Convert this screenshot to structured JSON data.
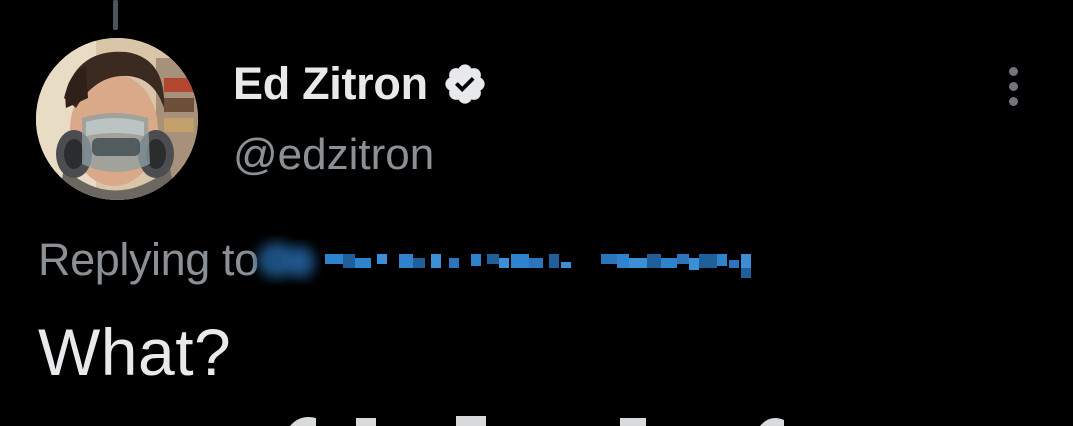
{
  "tweet": {
    "author": {
      "display_name": "Ed Zitron",
      "handle": "@edzitron",
      "verified": true,
      "avatar_icon": "profile-photo"
    },
    "reply_prefix": "Replying to",
    "reply_target_obscured": true,
    "text": "What?",
    "more_icon": "more-vertical-icon",
    "verified_icon": "verified-badge-icon"
  },
  "colors": {
    "background": "#000000",
    "primary_text": "#e7e9ea",
    "secondary_text": "#8b9095",
    "link_blue": "#1d9bf0",
    "thread_line": "#4e5459"
  }
}
